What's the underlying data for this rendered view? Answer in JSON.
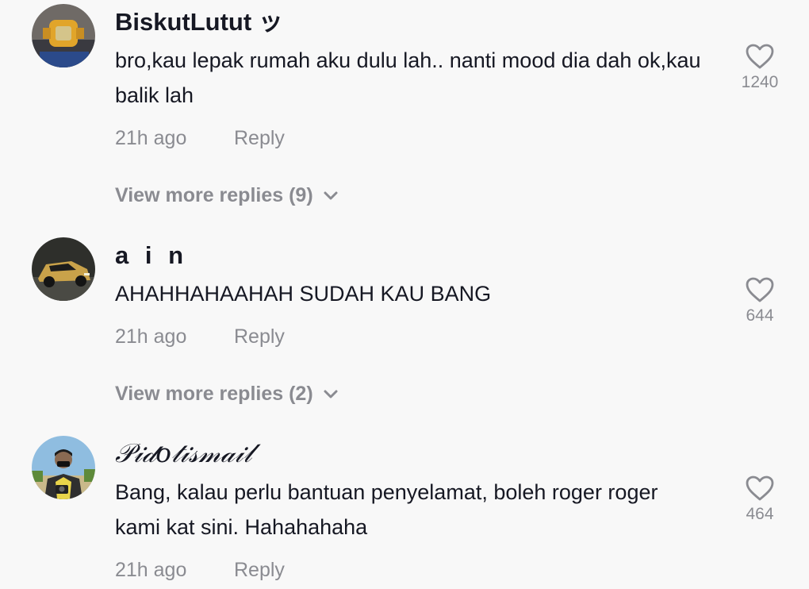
{
  "comments": [
    {
      "username": "BiskutLutut ッ",
      "text": "bro,kau lepak rumah aku dulu lah.. nanti mood dia dah ok,kau balik lah",
      "time": "21h ago",
      "reply_label": "Reply",
      "likes": "1240",
      "view_replies": "View more replies (9)",
      "avatar_icon": "watch-avatar"
    },
    {
      "username": "a i n",
      "text": "AHAHHAHAAHAH SUDAH KAU BANG",
      "time": "21h ago",
      "reply_label": "Reply",
      "likes": "644",
      "view_replies": "View more replies (2)",
      "avatar_icon": "car-avatar"
    },
    {
      "username": "𝒫𝒾𝒹𝑜𝓉𝒾𝓈𝓂𝒶𝒾𝓁",
      "text": "Bang, kalau perlu bantuan penyelamat, boleh roger roger kami kat sini. Hahahahaha",
      "time": "21h ago",
      "reply_label": "Reply",
      "likes": "464",
      "avatar_icon": "person-camera-avatar"
    }
  ],
  "colors": {
    "background": "#f8f8f8",
    "primary_text": "#161823",
    "secondary_text": "#8a8b91"
  }
}
